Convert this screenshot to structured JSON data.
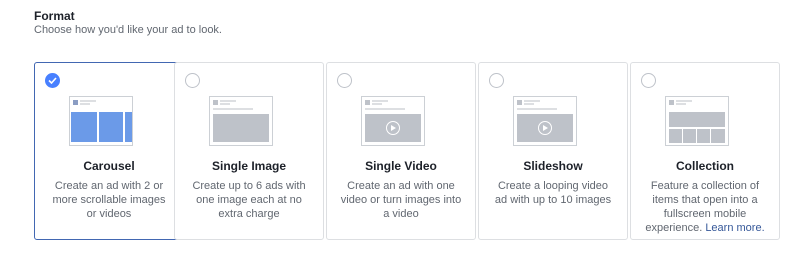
{
  "header": {
    "title": "Format",
    "subtitle": "Choose how you'd like your ad to look."
  },
  "formats": [
    {
      "title": "Carousel",
      "description": "Create an ad with 2 or more scrollable images or videos",
      "selected": true,
      "icon": "carousel-thumbnail"
    },
    {
      "title": "Single Image",
      "description": "Create up to 6 ads with one image each at no extra charge",
      "selected": false,
      "icon": "single-image-thumbnail"
    },
    {
      "title": "Single Video",
      "description": "Create an ad with one video or turn images into a video",
      "selected": false,
      "icon": "single-video-thumbnail"
    },
    {
      "title": "Slideshow",
      "description": "Create a looping video ad with up to 10 images",
      "selected": false,
      "icon": "slideshow-thumbnail"
    },
    {
      "title": "Collection",
      "description": "Feature a collection of items that open into a fullscreen mobile experience.",
      "link": "Learn more.",
      "selected": false,
      "icon": "collection-thumbnail"
    }
  ],
  "colors": {
    "accent": "#4267b2",
    "check": "#4880ff",
    "link": "#365899",
    "thumb_fill_selected": "#6b9ae8",
    "thumb_fill": "#bec2c9"
  }
}
